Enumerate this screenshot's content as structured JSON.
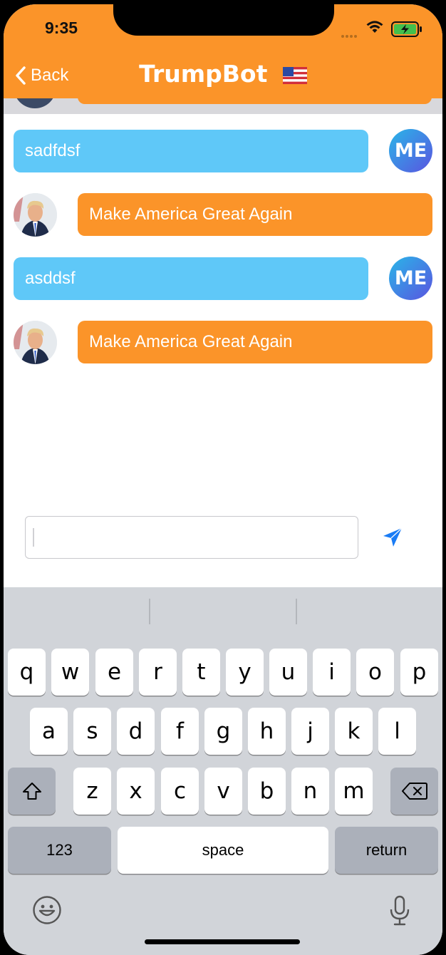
{
  "status_bar": {
    "time": "9:35"
  },
  "nav": {
    "back_label": "Back",
    "title": "TrumpBot"
  },
  "messages": [
    {
      "sender": "me",
      "text": "sadfdsf",
      "avatar_text": "ME"
    },
    {
      "sender": "bot",
      "text": "Make America Great Again"
    },
    {
      "sender": "me",
      "text": "asddsf",
      "avatar_text": "ME"
    },
    {
      "sender": "bot",
      "text": "Make America Great Again"
    }
  ],
  "composer": {
    "value": "",
    "placeholder": ""
  },
  "keyboard": {
    "row1": [
      "q",
      "w",
      "e",
      "r",
      "t",
      "y",
      "u",
      "i",
      "o",
      "p"
    ],
    "row2": [
      "a",
      "s",
      "d",
      "f",
      "g",
      "h",
      "j",
      "k",
      "l"
    ],
    "row3": [
      "z",
      "x",
      "c",
      "v",
      "b",
      "n",
      "m"
    ],
    "numbers_label": "123",
    "space_label": "space",
    "return_label": "return"
  },
  "colors": {
    "accent": "#fb9429",
    "me_bubble": "#5fc8f8",
    "send": "#1a7cf5"
  },
  "icons": [
    "chevron-left-icon",
    "wifi-icon",
    "battery-charging-icon",
    "us-flag-icon",
    "send-icon",
    "shift-icon",
    "backspace-icon",
    "emoji-icon",
    "microphone-icon"
  ]
}
